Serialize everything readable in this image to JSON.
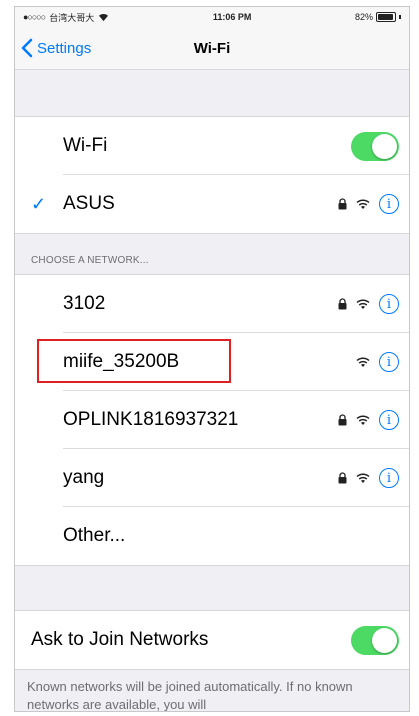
{
  "status_bar": {
    "carrier": "台湾大哥大",
    "time": "11:06 PM",
    "battery": "82%",
    "battery_level": 0.82
  },
  "nav": {
    "back_label": "Settings",
    "title": "Wi-Fi"
  },
  "wifi_toggle": {
    "label": "Wi-Fi",
    "on": true
  },
  "connected": {
    "name": "ASUS",
    "secured": true
  },
  "choose_header": "CHOOSE A NETWORK...",
  "networks": [
    {
      "name": "3102",
      "secured": true
    },
    {
      "name": "miife_35200B",
      "secured": false,
      "highlighted": true
    },
    {
      "name": "OPLINK1816937321",
      "secured": true
    },
    {
      "name": "yang",
      "secured": true
    },
    {
      "name": "Other..."
    }
  ],
  "ask_to_join": {
    "label": "Ask to Join Networks",
    "on": true
  },
  "footer_text": "Known networks will be joined automatically. If no known networks are available, you will",
  "colors": {
    "accent": "#007aff",
    "toggle_on": "#4cd964",
    "highlight": "#e02020"
  }
}
